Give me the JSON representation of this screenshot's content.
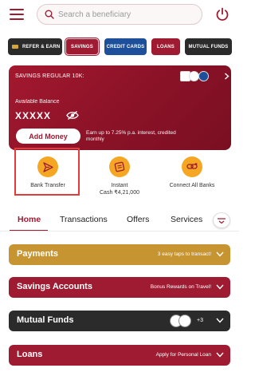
{
  "search": {
    "placeholder": "Search a beneficiary"
  },
  "categories": [
    {
      "label": "REFER & EARN"
    },
    {
      "label": "SAVINGS"
    },
    {
      "label": "CREDIT CARDS"
    },
    {
      "label": "LOANS"
    },
    {
      "label": "MUTUAL FUNDS"
    }
  ],
  "savings_card": {
    "title": "SAVINGS REGULAR 10K:",
    "available_label": "Available Balance",
    "balance_masked": "XXXXX",
    "add_money_label": "Add Money",
    "interest_text": "Earn up to 7.25% p.a. interest, credited monthly"
  },
  "quick_actions": [
    {
      "label": "Bank Transfer"
    },
    {
      "label_line1": "Instant",
      "label_line2": "Cash ₹4,21,000"
    },
    {
      "label": "Connect All Banks"
    }
  ],
  "nav_tabs": [
    {
      "label": "Home"
    },
    {
      "label": "Transactions"
    },
    {
      "label": "Offers"
    },
    {
      "label": "Services"
    }
  ],
  "sections": {
    "payments": {
      "name": "Payments",
      "hint": "3 easy taps to transact!"
    },
    "savings_accounts": {
      "name": "Savings Accounts",
      "hint": "Bonus Rewards on Travel!"
    },
    "mutual_funds": {
      "name": "Mutual Funds",
      "count": "+3"
    },
    "loans": {
      "name": "Loans",
      "hint": "Apply for Personal Loan"
    }
  },
  "colors": {
    "brand": "#9e1b32",
    "accent": "#f5a623",
    "payments_bar": "#c79432",
    "dark_bar": "#2b2b2b",
    "credit_cards": "#1d4f9a",
    "highlight": "#e23b3b"
  },
  "icons": [
    "hamburger-icon",
    "search-icon",
    "power-icon",
    "eye-slash-icon",
    "send-icon",
    "cash-icon",
    "link-bank-icon",
    "chevron-down-icon",
    "chevron-right-icon"
  ]
}
